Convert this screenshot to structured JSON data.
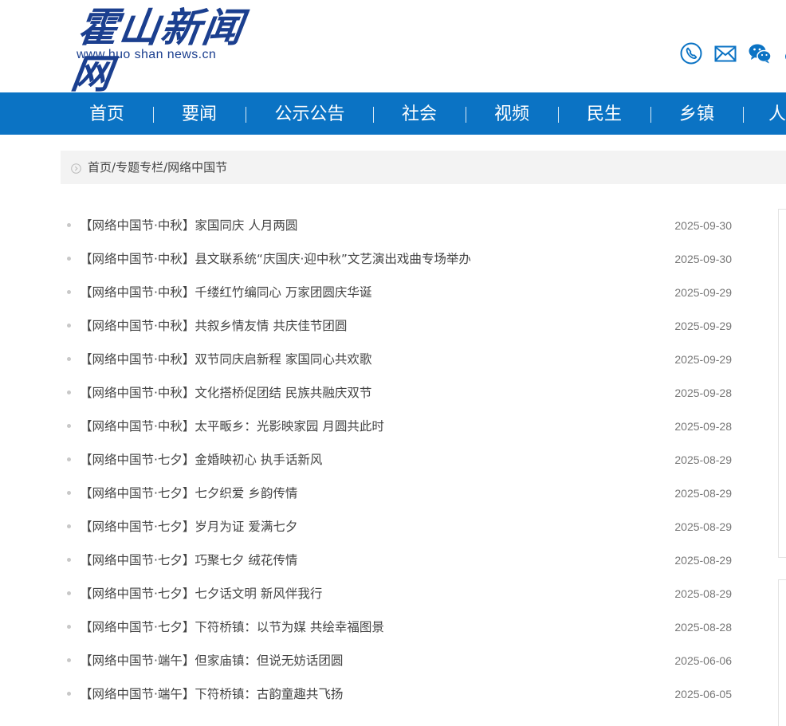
{
  "header": {
    "logo_text": "霍山新闻网",
    "logo_url_text": "www.huo shan news.cn",
    "icons": [
      "phone-icon",
      "mail-icon",
      "wechat-icon"
    ],
    "brand_color": "#1b3f8f"
  },
  "nav": {
    "bg_color": "#0b73c4",
    "items": [
      {
        "label": "首页"
      },
      {
        "label": "要闻"
      },
      {
        "label": "公示公告"
      },
      {
        "label": "社会"
      },
      {
        "label": "视频"
      },
      {
        "label": "民生"
      },
      {
        "label": "乡镇"
      },
      {
        "label": "人"
      }
    ]
  },
  "breadcrumb": {
    "home": "首页",
    "sep1": "/",
    "section": "专题专栏",
    "sep2": "/",
    "current": "网络中国节"
  },
  "articles": [
    {
      "title": "【网络中国节·中秋】家国同庆 人月两圆",
      "date": "2025-09-30"
    },
    {
      "title": "【网络中国节·中秋】县文联系统“庆国庆·迎中秋”文艺演出戏曲专场举办",
      "date": "2025-09-30"
    },
    {
      "title": "【网络中国节·中秋】千缕红竹编同心 万家团圆庆华诞",
      "date": "2025-09-29"
    },
    {
      "title": "【网络中国节·中秋】共叙乡情友情 共庆佳节团圆",
      "date": "2025-09-29"
    },
    {
      "title": "【网络中国节·中秋】双节同庆启新程 家国同心共欢歌",
      "date": "2025-09-29"
    },
    {
      "title": "【网络中国节·中秋】文化搭桥促团结 民族共融庆双节",
      "date": "2025-09-28"
    },
    {
      "title": "【网络中国节·中秋】太平畈乡：光影映家园 月圆共此时",
      "date": "2025-09-28"
    },
    {
      "title": "【网络中国节·七夕】金婚映初心 执手话新风",
      "date": "2025-08-29"
    },
    {
      "title": "【网络中国节·七夕】七夕织爱 乡韵传情",
      "date": "2025-08-29"
    },
    {
      "title": "【网络中国节·七夕】岁月为证 爱满七夕",
      "date": "2025-08-29"
    },
    {
      "title": "【网络中国节·七夕】巧聚七夕 绒花传情",
      "date": "2025-08-29"
    },
    {
      "title": "【网络中国节·七夕】七夕话文明 新风伴我行",
      "date": "2025-08-29"
    },
    {
      "title": "【网络中国节·七夕】下符桥镇：以节为媒 共绘幸福图景",
      "date": "2025-08-28"
    },
    {
      "title": "【网络中国节·端午】但家庙镇：但说无妨话团圆",
      "date": "2025-06-06"
    },
    {
      "title": "【网络中国节·端午】下符桥镇：古韵童趣共飞扬",
      "date": "2025-06-05"
    }
  ]
}
